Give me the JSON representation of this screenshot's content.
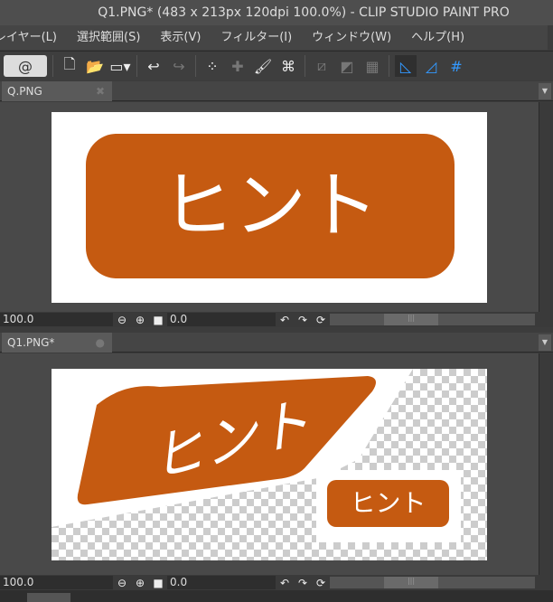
{
  "window": {
    "title": "Q1.PNG* (483 x 213px 120dpi 100.0%)  - CLIP STUDIO PAINT PRO"
  },
  "menu": [
    "レイヤー(L)",
    "選択範囲(S)",
    "表示(V)",
    "フィルター(I)",
    "ウィンドウ(W)",
    "ヘルプ(H)"
  ],
  "tabs": [
    {
      "label": "Q.PNG"
    },
    {
      "label": "Q1.PNG*"
    }
  ],
  "canvas": {
    "text": "ヒント",
    "accent": "#c55a11"
  },
  "status": [
    {
      "zoom": "100.0",
      "angle": "0.0"
    },
    {
      "zoom": "100.0",
      "angle": "0.0"
    }
  ]
}
